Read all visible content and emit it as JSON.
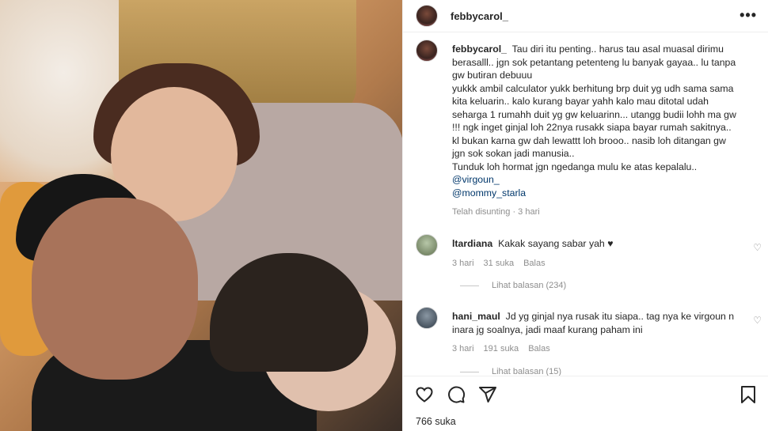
{
  "header": {
    "username": "febbycarol_",
    "more": "•••"
  },
  "caption": {
    "username": "febbycarol_",
    "text": "Tau diri itu penting.. harus tau asal muasal dirimu berasalll.. jgn sok petantang petenteng lu banyak gayaa.. lu tanpa gw butiran debuuu\nyukkk ambil calculator yukk berhitung brp duit yg udh sama sama kita keluarin.. kalo kurang bayar yahh kalo mau ditotal udah seharga 1 rumahh duit yg gw keluarinn... utangg budii lohh ma gw !!! ngk inget ginjal loh 22nya rusakk siapa bayar rumah sakitnya.. kl bukan karna gw dah lewattt loh brooo.. nasib loh ditangan gw jgn sok sokan jadi manusia..\nTunduk loh hormat jgn ngedanga mulu ke atas kepalalu..",
    "mentions": [
      "@virgoun_",
      "@mommy_starla"
    ],
    "meta": "Telah disunting · 3 hari"
  },
  "comments": [
    {
      "username": "ltardiana",
      "text": "Kakak sayang sabar yah ♥",
      "time": "3 hari",
      "likes": "31 suka",
      "reply": "Balas",
      "view_replies": "Lihat balasan (234)"
    },
    {
      "username": "hani_maul",
      "text": "Jd yg ginjal nya rusak itu siapa.. tag nya ke virgoun n inara jg soalnya, jadi maaf kurang paham ini",
      "time": "3 hari",
      "likes": "191 suka",
      "reply": "Balas",
      "view_replies": "Lihat balasan (15)"
    }
  ],
  "footer": {
    "likes": "766 suka"
  },
  "icons": {
    "like": "heart-icon",
    "comment": "comment-icon",
    "share": "share-icon",
    "save": "bookmark-icon",
    "comment_like": "heart-outline-icon"
  },
  "colors": {
    "mention": "#00376b",
    "muted": "#8e8e8e",
    "text": "#262626"
  }
}
